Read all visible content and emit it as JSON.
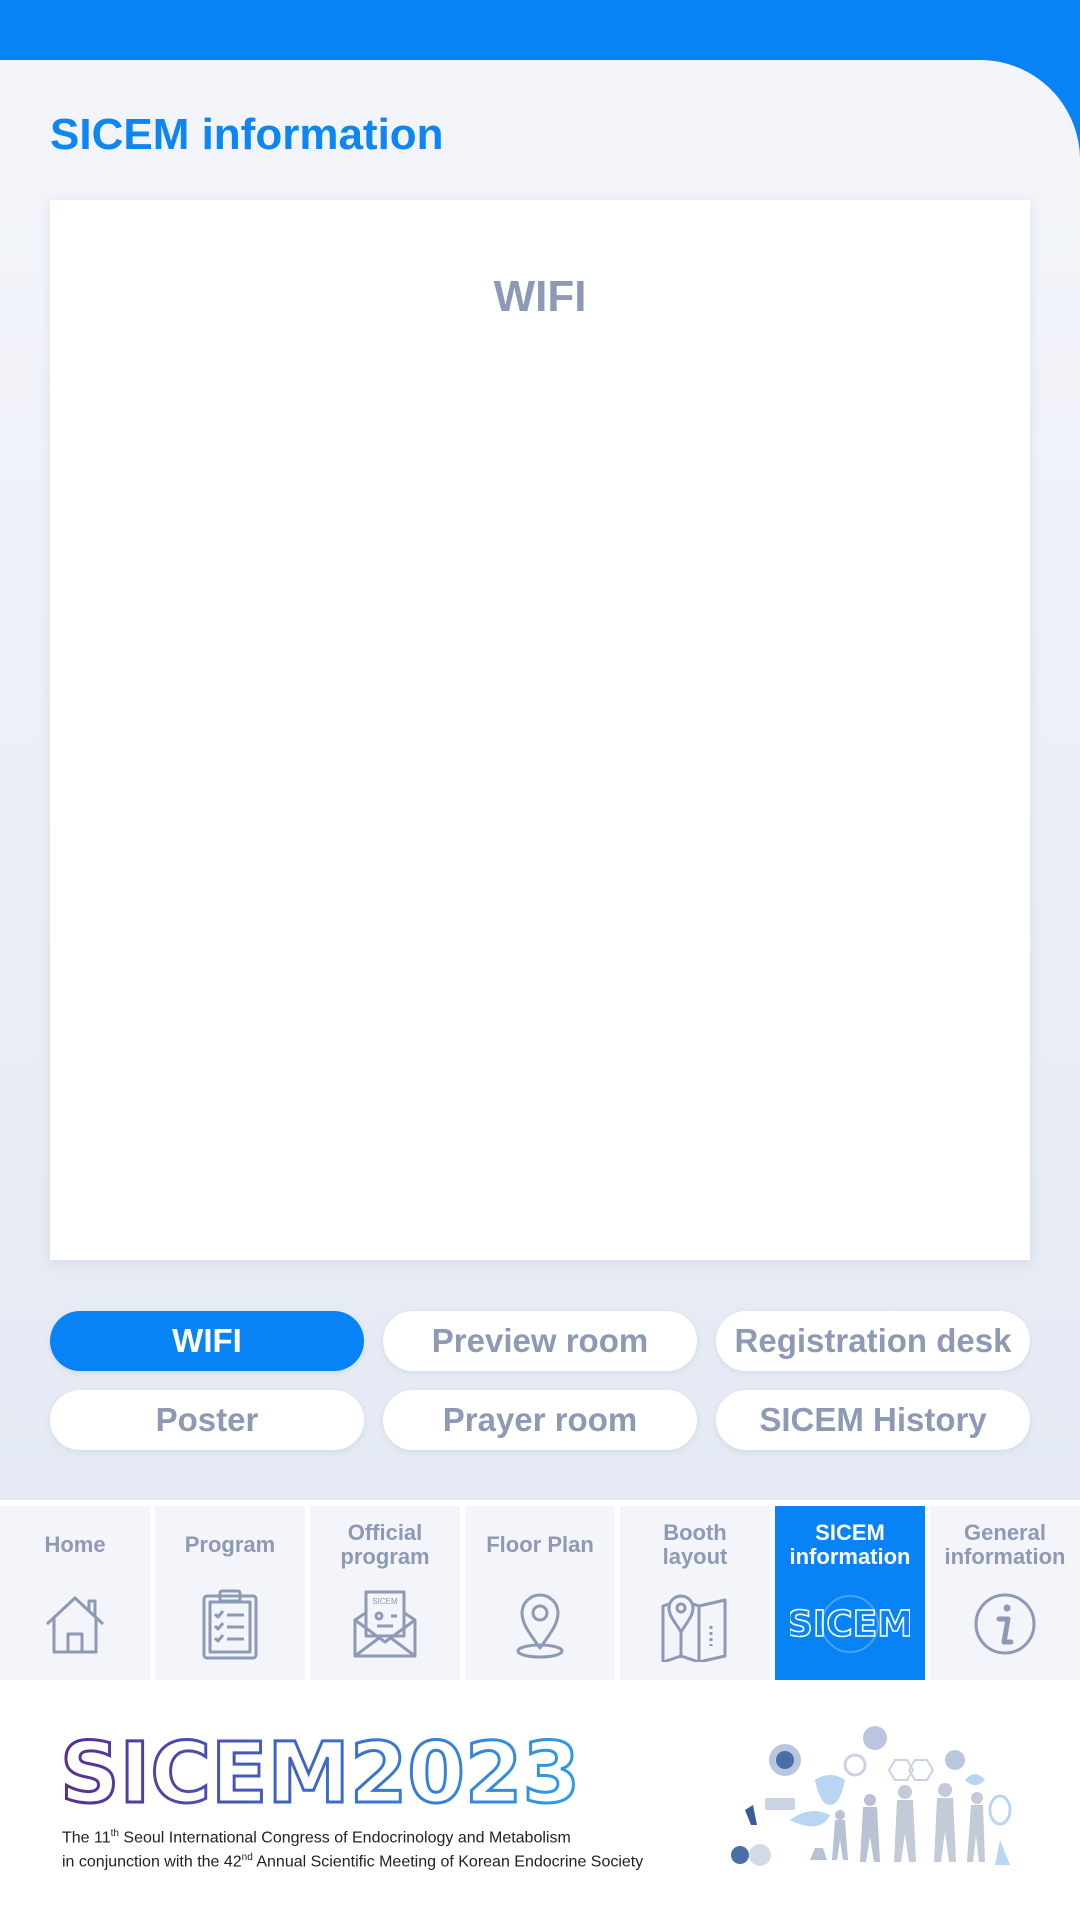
{
  "page_title": "SICEM information",
  "panel": {
    "title": "WIFI"
  },
  "tabs": [
    {
      "label": "WIFI",
      "active": true
    },
    {
      "label": "Preview room",
      "active": false
    },
    {
      "label": "Registration desk",
      "active": false
    },
    {
      "label": "Poster",
      "active": false
    },
    {
      "label": "Prayer room",
      "active": false
    },
    {
      "label": "SICEM History",
      "active": false
    }
  ],
  "nav": [
    {
      "line1": "Home",
      "line2": "",
      "icon": "home-icon"
    },
    {
      "line1": "Program",
      "line2": "",
      "icon": "clipboard-checklist-icon"
    },
    {
      "line1": "Official",
      "line2": "program",
      "icon": "envelope-icon"
    },
    {
      "line1": "Floor Plan",
      "line2": "",
      "icon": "map-pin-icon"
    },
    {
      "line1": "Booth",
      "line2": "layout",
      "icon": "folded-map-icon"
    },
    {
      "line1": "SICEM",
      "line2": "information",
      "icon": "sicem-logo-icon",
      "active": true
    },
    {
      "line1": "General",
      "line2": "information",
      "icon": "info-icon"
    }
  ],
  "nav_icon_texts": {
    "envelope_badge": "SICEM",
    "sicem_icon": "SICEM"
  },
  "footer": {
    "logo_word": "SICEM",
    "logo_year": "2023",
    "tagline1_a": "The 11",
    "tagline1_sup": "th",
    "tagline1_b": " Seoul International Congress of Endocrinology and Metabolism",
    "tagline2_a": "in conjunction with the 42",
    "tagline2_sup": "nd",
    "tagline2_b": " Annual Scientific Meeting of Korean Endocrine Society"
  },
  "colors": {
    "primary": "#0883f6",
    "muted_text": "#8d99b5",
    "background": "#eef1f8",
    "logo_purple": "#5a2d91",
    "logo_blue": "#2d9be8"
  }
}
